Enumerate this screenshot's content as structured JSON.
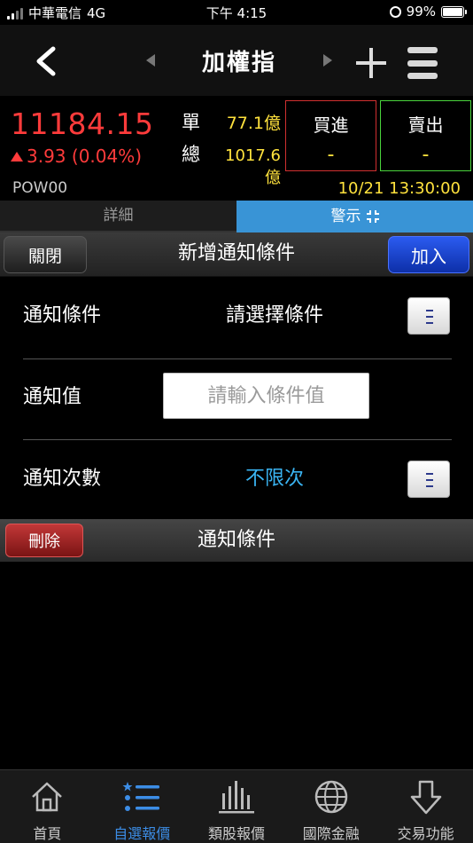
{
  "status_bar": {
    "carrier": "中華電信",
    "network": "4G",
    "time": "下午 4:15",
    "battery": "99%"
  },
  "header": {
    "title": "加權指"
  },
  "quote": {
    "price": "11184.15",
    "change": "3.93 (0.04%)",
    "single_label": "單",
    "single_volume": "77.1億",
    "total_label": "總",
    "total_volume": "1017.6 億",
    "buy_label": "買進",
    "buy_value": "-",
    "sell_label": "賣出",
    "sell_value": "-",
    "code": "POW00",
    "datetime": "10/21 13:30:00",
    "colors": {
      "up": "#ff3b3b",
      "highlight": "#ffe23d",
      "buy_border": "#d13030",
      "sell_border": "#4ad43c"
    }
  },
  "tabs": [
    {
      "label": "詳細",
      "active": false
    },
    {
      "label": "警示",
      "active": true
    }
  ],
  "action_bar": {
    "close_label": "關閉",
    "title": "新增通知條件",
    "add_label": "加入"
  },
  "form": {
    "condition_label": "通知條件",
    "condition_value": "請選擇條件",
    "value_label": "通知值",
    "value_placeholder": "請輸入條件值",
    "count_label": "通知次數",
    "count_value": "不限次"
  },
  "list_bar": {
    "delete_label": "刪除",
    "title": "通知條件"
  },
  "bottom_nav": [
    {
      "label": "首頁",
      "icon": "home-icon",
      "active": false
    },
    {
      "label": "自選報價",
      "icon": "list-icon",
      "active": true
    },
    {
      "label": "類股報價",
      "icon": "bar-chart-icon",
      "active": false
    },
    {
      "label": "國際金融",
      "icon": "globe-icon",
      "active": false
    },
    {
      "label": "交易功能",
      "icon": "download-arrow-icon",
      "active": false
    }
  ]
}
